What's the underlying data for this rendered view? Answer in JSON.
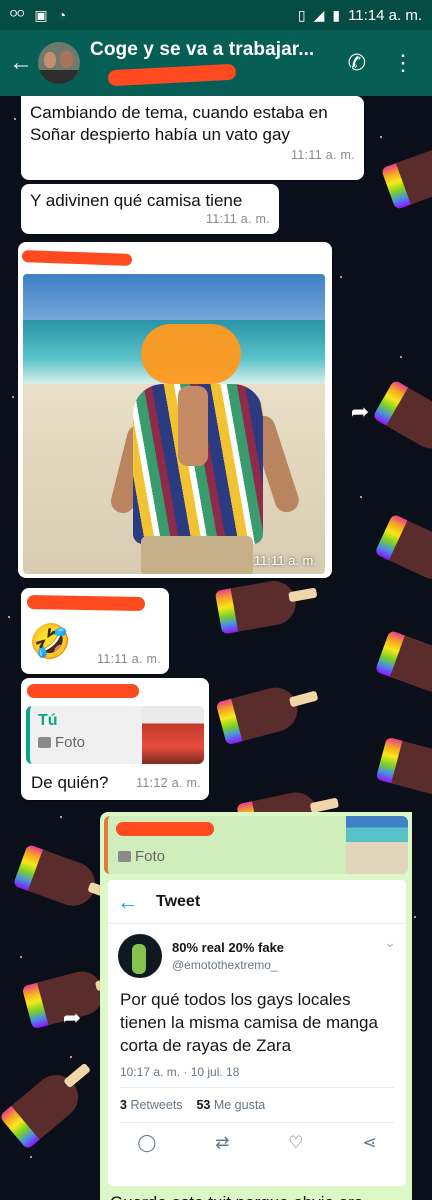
{
  "status_bar": {
    "time": "11:14 a. m.",
    "icons": [
      "voicemail-icon",
      "image-icon",
      "wifi-icon",
      "vibrate-icon",
      "signal-icon",
      "battery-icon"
    ]
  },
  "header": {
    "title": "Coge y se va a trabajar...",
    "subtitle": "",
    "actions": [
      "add-call-icon",
      "more-vert-icon"
    ]
  },
  "messages": [
    {
      "text": "Cambiando de tema, cuando estaba en Soñar despierto había un vato gay",
      "time": "11:11 a. m."
    },
    {
      "text": "Y adivinen qué camisa tiene",
      "time": "11:11 a. m."
    },
    {
      "type": "photo",
      "time": "11:11 a. m."
    },
    {
      "emoji": "🤣",
      "time": "11:11 a. m."
    },
    {
      "reply_author": "Tú",
      "reply_type": "Foto",
      "text": "De quién?",
      "time": "11:12 a. m."
    }
  ],
  "outgoing": {
    "reply_type": "Foto",
    "tweet": {
      "header": "Tweet",
      "name": "80% real 20% fake",
      "handle": "@emotothextremo_",
      "body": "Por qué todos los gays locales tienen la misma camisa de manga corta de rayas de Zara",
      "date": "10:17 a. m. · 10 jul. 18",
      "retweets": "3",
      "retweets_label": "Retweets",
      "likes": "53",
      "likes_label": "Me gusta"
    },
    "caption": "Guarde este tuit porque obvio era"
  }
}
